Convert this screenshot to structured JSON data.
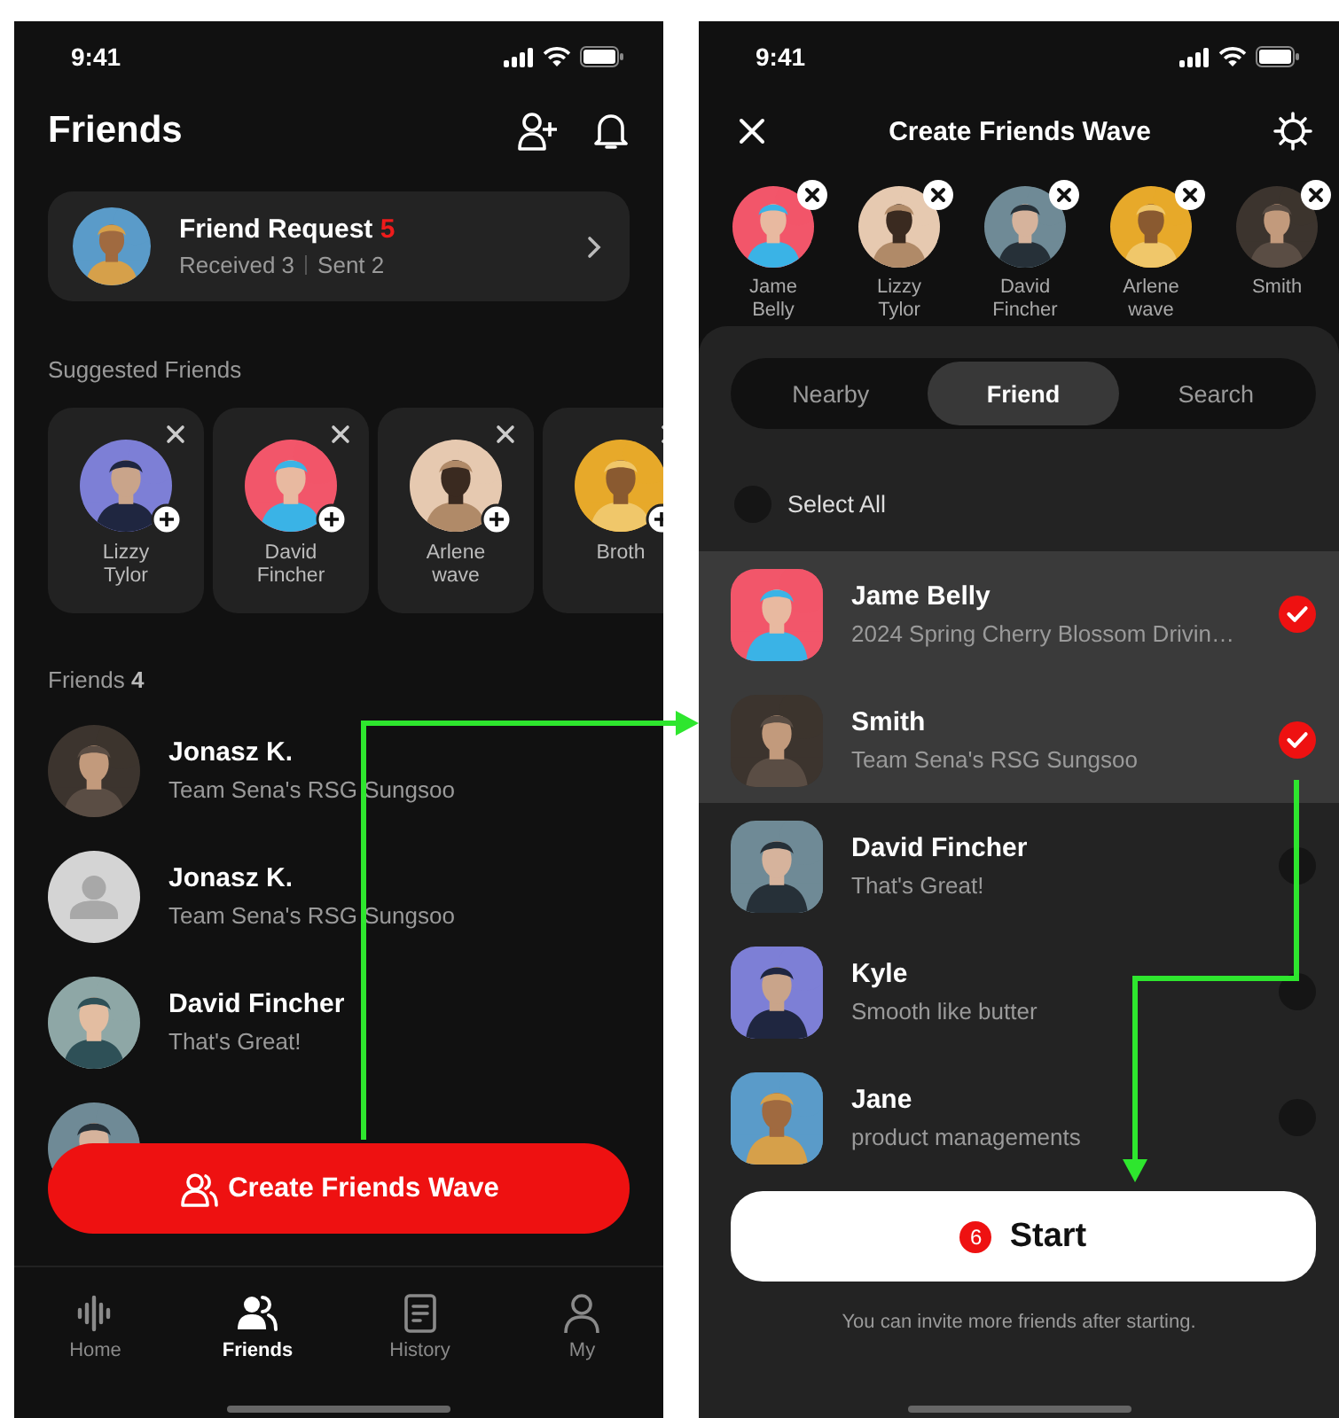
{
  "friends_screen": {
    "status_bar": {
      "time": "9:41"
    },
    "title": "Friends",
    "friend_request": {
      "title": "Friend Request",
      "count": "5",
      "received": "Received 3",
      "sent": "Sent 2"
    },
    "suggested": {
      "heading": "Suggested Friends",
      "people": [
        {
          "name": "Lizzy Tylor"
        },
        {
          "name": "David Fincher"
        },
        {
          "name": "Arlene wave"
        },
        {
          "name": "Broth"
        }
      ]
    },
    "friends": {
      "heading": "Friends",
      "count": "4",
      "rows": [
        {
          "kind": "picture",
          "name": "Jonasz K.",
          "status": "Team Sena's RSG Sungsoo"
        },
        {
          "kind": "placeholder",
          "name": "Jonasz K.",
          "status": "Team Sena's RSG Sungsoo"
        },
        {
          "kind": "picture",
          "name": "David Fincher",
          "status": "That's Great!"
        },
        {
          "kind": "picture"
        }
      ]
    },
    "create_button": "Create Friends Wave",
    "nav": [
      {
        "label": "Home",
        "kind": "wave",
        "selected": false
      },
      {
        "label": "Friends",
        "kind": "people",
        "selected": true
      },
      {
        "label": "History",
        "kind": "document",
        "selected": false
      },
      {
        "label": "My",
        "kind": "person",
        "selected": false
      }
    ]
  },
  "wave_screen": {
    "status_bar": {
      "time": "9:41"
    },
    "title": "Create Friends Wave",
    "chosen": [
      {
        "name": "Jame Belly"
      },
      {
        "name": "Lizzy Tylor"
      },
      {
        "name": "David Fincher"
      },
      {
        "name": "Arlene wave"
      },
      {
        "name": "Smith"
      }
    ],
    "segments": [
      {
        "label": "Nearby",
        "selected": false
      },
      {
        "label": "Friend",
        "selected": true
      },
      {
        "label": "Search",
        "selected": false
      }
    ],
    "select_all": {
      "label": "Select All",
      "checked": false
    },
    "rows": [
      {
        "name": "Jame Belly",
        "status": "2024 Spring Cherry Blossom Drivin…",
        "selected": true
      },
      {
        "name": "Smith",
        "status": "Team Sena's RSG Sungsoo",
        "selected": true
      },
      {
        "name": "David Fincher",
        "status": "That's Great!",
        "selected": false
      },
      {
        "name": "Kyle",
        "status": "Smooth like butter",
        "selected": false
      },
      {
        "name": "Jane",
        "status": "product managements",
        "selected": false
      }
    ],
    "start": {
      "count": "6",
      "label": "Start"
    },
    "note": "You can invite more friends after starting."
  }
}
